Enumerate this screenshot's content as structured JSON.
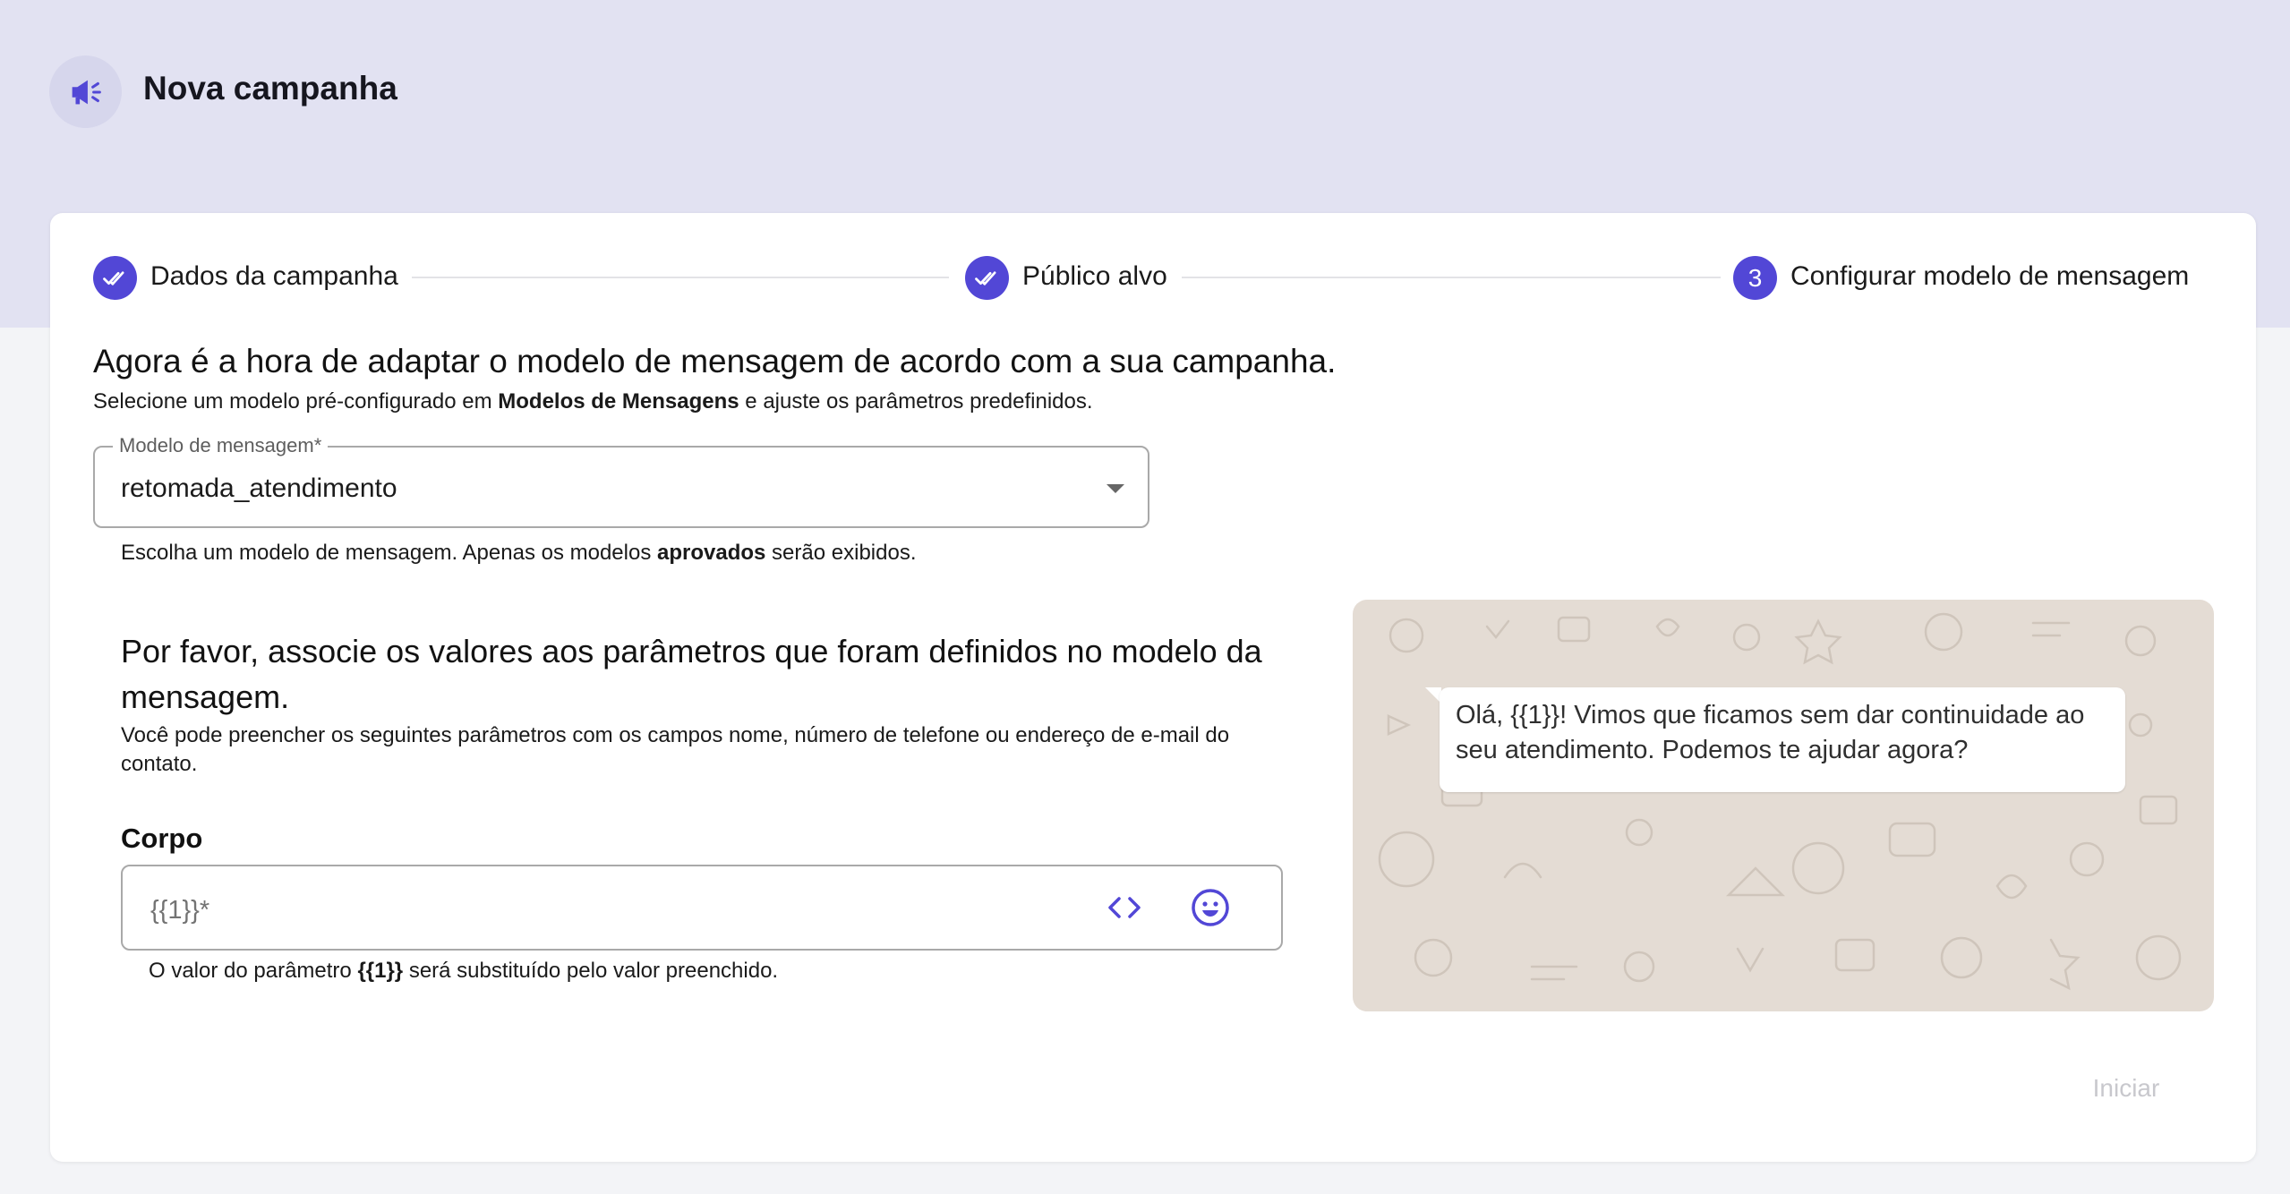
{
  "header": {
    "icon": "megaphone-icon",
    "title": "Nova campanha"
  },
  "steps": [
    {
      "label": "Dados da campanha",
      "status": "done",
      "icon": "double-check-icon"
    },
    {
      "label": "Público alvo",
      "status": "done",
      "icon": "double-check-icon"
    },
    {
      "label": "Configurar modelo de mensagem",
      "status": "current",
      "number": "3"
    }
  ],
  "main": {
    "title": "Agora é a hora de adaptar o modelo de mensagem de acordo com a sua campanha.",
    "subtitle_before": "Selecione um modelo pré-configurado em ",
    "subtitle_bold": "Modelos de Mensagens",
    "subtitle_after": " e ajuste os parâmetros predefinidos."
  },
  "template_select": {
    "label": "Modelo de mensagem",
    "required_mark": "*",
    "value": "retomada_atendimento",
    "helper_before": "Escolha um modelo de mensagem. Apenas os modelos ",
    "helper_bold": "aprovados",
    "helper_after": " serão exibidos."
  },
  "params": {
    "title": "Por favor, associe os valores aos parâmetros que foram definidos no modelo da mensagem.",
    "description": "Você pode preencher os seguintes parâmetros com os campos nome, número de telefone ou endereço de e-mail do contato.",
    "section_label": "Corpo",
    "input_placeholder": "{{1}}*",
    "input_value": "",
    "helper_before": "O valor do parâmetro ",
    "helper_bold": "{{1}}",
    "helper_after": " será substituído pelo valor preenchido."
  },
  "preview": {
    "message": "Olá, {{1}}! Vimos que ficamos sem dar continuidade ao seu atendimento. Podemos te ajudar agora?"
  },
  "actions": {
    "start_label": "Iniciar",
    "start_enabled": false
  },
  "colors": {
    "accent": "#5247d6",
    "header_band": "#e2e2f2",
    "preview_bg": "#e4dcd4"
  }
}
